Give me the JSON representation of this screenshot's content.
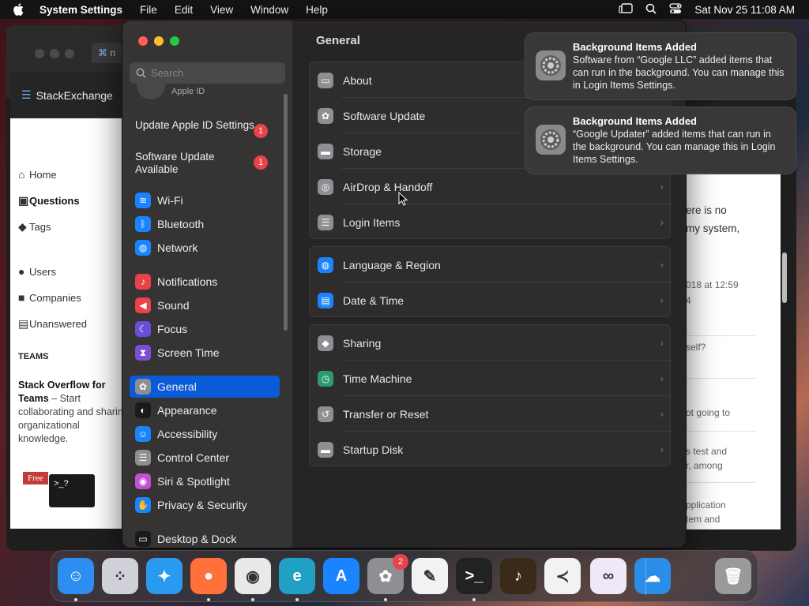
{
  "menubar": {
    "app": "System Settings",
    "menus": [
      "File",
      "Edit",
      "View",
      "Window",
      "Help"
    ],
    "datetime": "Sat Nov 25  11:08 AM"
  },
  "browser": {
    "tab_label": "n",
    "brand": "StackExchange",
    "left_nav": [
      {
        "label": "Home",
        "icon": "home-icon"
      },
      {
        "label": "Questions",
        "icon": "questions-icon"
      },
      {
        "label": "Tags",
        "icon": "tag-icon"
      },
      {
        "label": "Users",
        "icon": "users-icon"
      },
      {
        "label": "Companies",
        "icon": "companies-icon"
      },
      {
        "label": "Unanswered",
        "icon": "unanswered-icon"
      }
    ],
    "teams_heading": "TEAMS",
    "teams_title": "Stack Overflow for Teams",
    "teams_body": "– Start collaborating and sharing organizational knowledge.",
    "free_badge": "Free",
    "terminal_text": ">_?",
    "right_texts": [
      "ere is no",
      "my system,",
      "018 at 12:59",
      "4",
      "self?",
      "ot going to",
      "s test and",
      "r, among",
      "pplication",
      "tem and"
    ]
  },
  "settings": {
    "search_placeholder": "Search",
    "apple_id_label": "Apple ID",
    "updates": [
      {
        "label": "Update Apple ID Settings",
        "badge": "1"
      },
      {
        "label": "Software Update Available",
        "badge": "1"
      }
    ],
    "sidebar": [
      {
        "label": "Wi-Fi",
        "color": "#1a84ff",
        "icon": "wifi-icon"
      },
      {
        "label": "Bluetooth",
        "color": "#1a84ff",
        "icon": "bluetooth-icon"
      },
      {
        "label": "Network",
        "color": "#1a84ff",
        "icon": "globe-icon"
      },
      {
        "label": "Notifications",
        "color": "#e8424a",
        "icon": "bell-icon"
      },
      {
        "label": "Sound",
        "color": "#e8424a",
        "icon": "speaker-icon"
      },
      {
        "label": "Focus",
        "color": "#6a4fd6",
        "icon": "moon-icon"
      },
      {
        "label": "Screen Time",
        "color": "#7a4fd6",
        "icon": "hourglass-icon"
      },
      {
        "label": "General",
        "color": "#8e8e93",
        "icon": "gear-icon",
        "selected": true
      },
      {
        "label": "Appearance",
        "color": "#1a1a1a",
        "icon": "appearance-icon"
      },
      {
        "label": "Accessibility",
        "color": "#1a84ff",
        "icon": "accessibility-icon"
      },
      {
        "label": "Control Center",
        "color": "#8e8e93",
        "icon": "control-center-icon"
      },
      {
        "label": "Siri & Spotlight",
        "color": "#c24fd6",
        "icon": "siri-icon"
      },
      {
        "label": "Privacy & Security",
        "color": "#1a84ff",
        "icon": "hand-icon"
      },
      {
        "label": "Desktop & Dock",
        "color": "#1a1a1a",
        "icon": "dock-icon"
      }
    ],
    "content_title": "General",
    "groups": [
      [
        {
          "label": "About",
          "icon": "laptop-icon",
          "color": "#8e8e93"
        },
        {
          "label": "Software Update",
          "icon": "gear-badge-icon",
          "color": "#8e8e93"
        },
        {
          "label": "Storage",
          "icon": "disk-icon",
          "color": "#8e8e93"
        },
        {
          "label": "AirDrop & Handoff",
          "icon": "airdrop-icon",
          "color": "#8e8e93"
        },
        {
          "label": "Login Items",
          "icon": "list-icon",
          "color": "#8e8e93"
        }
      ],
      [
        {
          "label": "Language & Region",
          "icon": "globe-icon",
          "color": "#1a84ff"
        },
        {
          "label": "Date & Time",
          "icon": "calendar-icon",
          "color": "#1a84ff"
        }
      ],
      [
        {
          "label": "Sharing",
          "icon": "sharing-icon",
          "color": "#8e8e93"
        },
        {
          "label": "Time Machine",
          "icon": "clock-icon",
          "color": "#2a9d6e"
        },
        {
          "label": "Transfer or Reset",
          "icon": "reset-icon",
          "color": "#8e8e93"
        },
        {
          "label": "Startup Disk",
          "icon": "disk-icon",
          "color": "#8e8e93"
        }
      ]
    ]
  },
  "notifications": [
    {
      "title": "Background Items Added",
      "body": "Software from “Google LLC” added items that can run in the background. You can manage this in Login Items Settings."
    },
    {
      "title": "Background Items Added",
      "body": "“Google Updater” added items that can run in the background. You can manage this in Login Items Settings."
    }
  ],
  "dock": {
    "settings_badge": "2",
    "apps": [
      {
        "name": "Finder",
        "color": "#2b8ef0",
        "icon": "finder-icon"
      },
      {
        "name": "Launchpad",
        "color": "#d0d0d8",
        "icon": "launchpad-icon"
      },
      {
        "name": "Safari",
        "color": "#2a9af0",
        "icon": "compass-icon"
      },
      {
        "name": "Firefox",
        "color": "#ff7139",
        "icon": "firefox-icon"
      },
      {
        "name": "Chrome",
        "color": "#e9e9e9",
        "icon": "chrome-icon"
      },
      {
        "name": "Edge",
        "color": "#1fa0c4",
        "icon": "edge-icon"
      },
      {
        "name": "App Store",
        "color": "#1a84ff",
        "icon": "appstore-icon"
      },
      {
        "name": "System Settings",
        "color": "#8e8e93",
        "icon": "gear-icon"
      },
      {
        "name": "TextEdit",
        "color": "#f2f2f2",
        "icon": "textedit-icon"
      },
      {
        "name": "Terminal",
        "color": "#222",
        "icon": "terminal-icon"
      },
      {
        "name": "GarageBand",
        "color": "#3a2a1a",
        "icon": "guitar-icon"
      },
      {
        "name": "VS Code",
        "color": "#f2f2f2",
        "icon": "vscode-icon"
      },
      {
        "name": "Visual Studio",
        "color": "#efe8f7",
        "icon": "visual-studio-icon"
      },
      {
        "name": "Weather",
        "color": "#2a8ee8",
        "icon": "weather-icon"
      },
      {
        "name": "Trash",
        "color": "#9a9a9a",
        "icon": "trash-icon"
      }
    ]
  }
}
